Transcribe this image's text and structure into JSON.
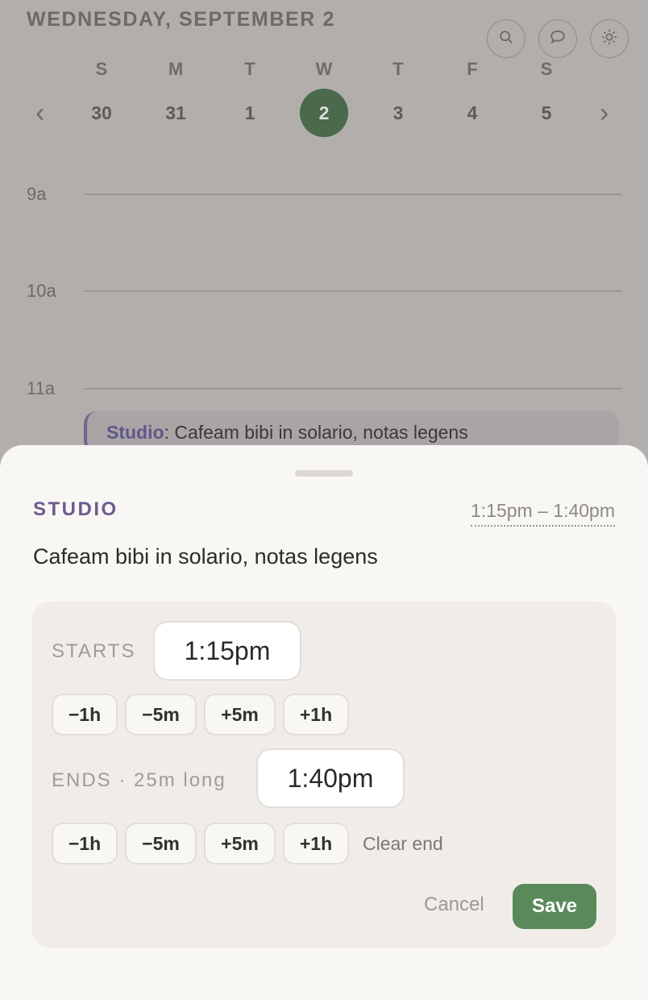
{
  "header": {
    "date_title": "WEDNESDAY, SEPTEMBER 2",
    "icons": [
      "search-icon",
      "chat-icon",
      "brightness-icon"
    ]
  },
  "week": {
    "prev": "‹",
    "next": "›",
    "days": [
      {
        "dow": "S",
        "num": "30"
      },
      {
        "dow": "M",
        "num": "31"
      },
      {
        "dow": "T",
        "num": "1"
      },
      {
        "dow": "W",
        "num": "2",
        "selected": true
      },
      {
        "dow": "T",
        "num": "3"
      },
      {
        "dow": "F",
        "num": "4"
      },
      {
        "dow": "S",
        "num": "5"
      }
    ]
  },
  "timeline": {
    "hours": [
      "9a",
      "10a",
      "11a"
    ],
    "event": {
      "category": "Studio",
      "separator": ":",
      "title": " Cafeam bibi in solario, notas legens"
    }
  },
  "sheet": {
    "category": "STUDIO",
    "range": "1:15pm – 1:40pm",
    "title": "Cafeam bibi in solario, notas legens",
    "starts_label": "STARTS",
    "start_time": "1:15pm",
    "ends_label": "ENDS · 25m long",
    "end_time": "1:40pm",
    "adjust": [
      "−1h",
      "−5m",
      "+5m",
      "+1h"
    ],
    "clear_end": "Clear end",
    "cancel": "Cancel",
    "save": "Save"
  },
  "colors": {
    "accent_green": "#5a8a5c",
    "selected_day": "#4a6a4b",
    "category_purple": "#6a5c8f"
  }
}
